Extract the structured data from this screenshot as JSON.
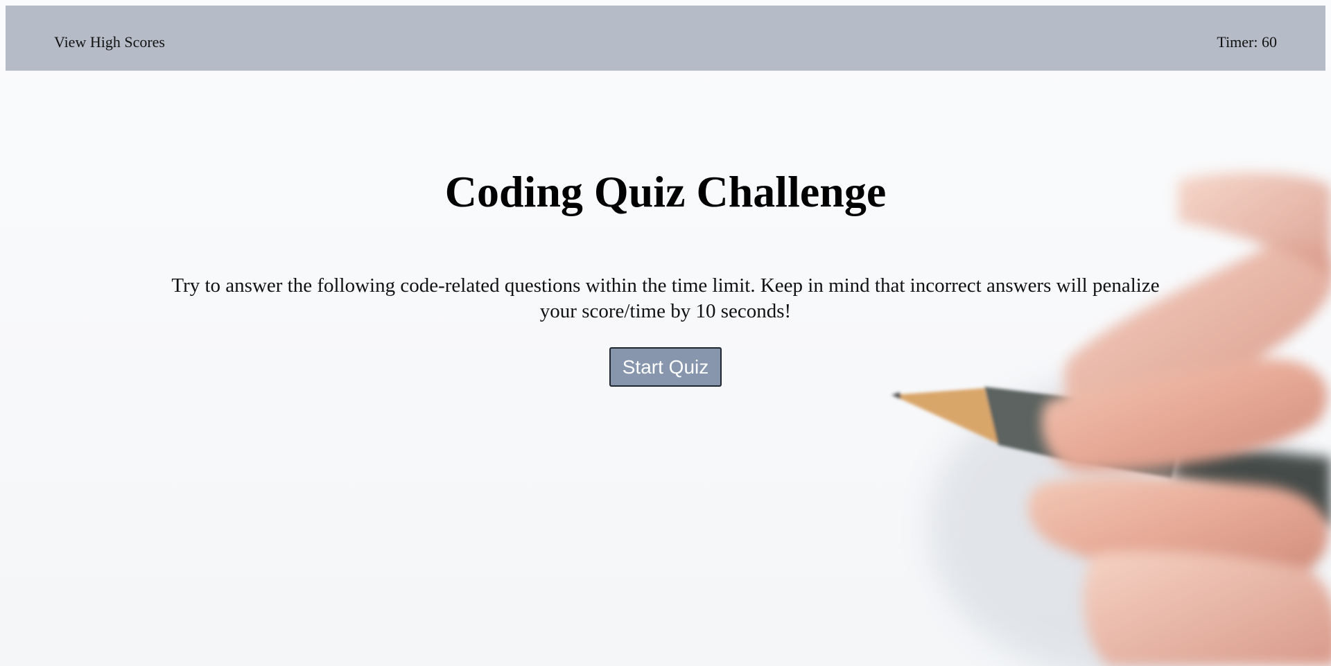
{
  "header": {
    "high_scores_label": "View High Scores",
    "timer_text": "Timer: 60"
  },
  "main": {
    "title": "Coding Quiz Challenge",
    "intro": "Try to answer the following code-related questions within the time limit. Keep in mind that incorrect answers will penalize your score/time by 10 seconds!",
    "start_button_label": "Start Quiz"
  },
  "colors": {
    "header_bg": "#b5bcc7",
    "button_bg": "#8896ad",
    "page_bg": "#f9fafb"
  },
  "background_image": "hand-holding-pencil-photo"
}
